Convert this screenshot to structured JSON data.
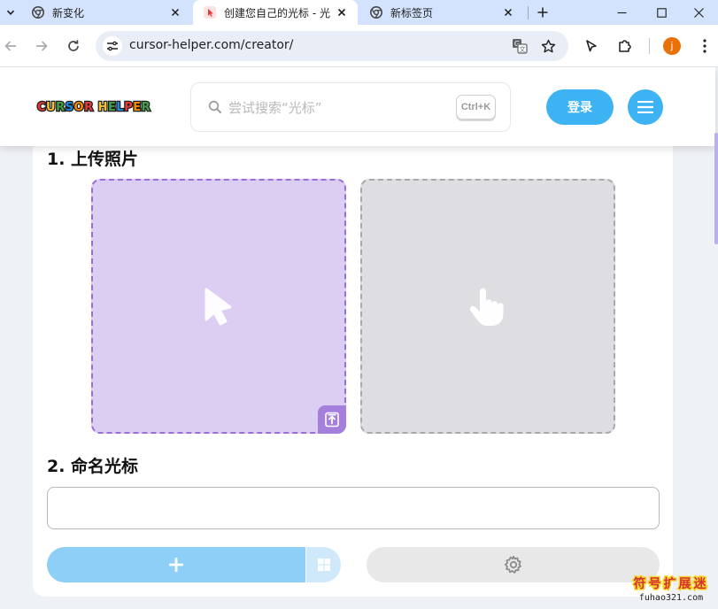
{
  "browser": {
    "tabs": [
      {
        "title": "新变化",
        "active": false,
        "favicon": "chrome-icon"
      },
      {
        "title": "创建您自己的光标 - 光",
        "active": true,
        "favicon": "cursor-helper-favicon"
      },
      {
        "title": "新标签页",
        "active": false,
        "favicon": "chrome-icon"
      }
    ],
    "url": "cursor-helper.com/creator/",
    "profile_initial": "j",
    "colors": {
      "tabstrip": "#d3e3fd",
      "omnibox": "#e9eef6",
      "profile": "#e8710a"
    }
  },
  "header": {
    "logo": {
      "text": "CURSOR HELPER",
      "letter_colors": [
        "#e53935",
        "#fbc02d",
        "#43a047",
        "#1e88e5",
        "#fb8c00",
        "#e53935",
        "#ffffff",
        "#fbc02d",
        "#43a047",
        "#1e88e5",
        "#e53935",
        "#fb8c00",
        "#43a047"
      ]
    },
    "search_placeholder": "尝试搜索“光标”",
    "search_shortcut": "Ctrl+K",
    "login_label": "登录",
    "accent_color": "#3eb3f4"
  },
  "creator": {
    "section_upload_title": "1. 上传照片",
    "section_name_title": "2. 命名光标",
    "name_value": "",
    "drop_normal_icon": "arrow-cursor-icon",
    "drop_pointer_icon": "hand-pointer-icon",
    "upload_icon": "upload-arrow-icon",
    "add_icon": "plus-icon",
    "windows_icon": "windows-icon",
    "settings_icon": "gear-icon"
  },
  "watermark": {
    "line1": "符号扩展迷",
    "line2": "fuhao321.com"
  }
}
